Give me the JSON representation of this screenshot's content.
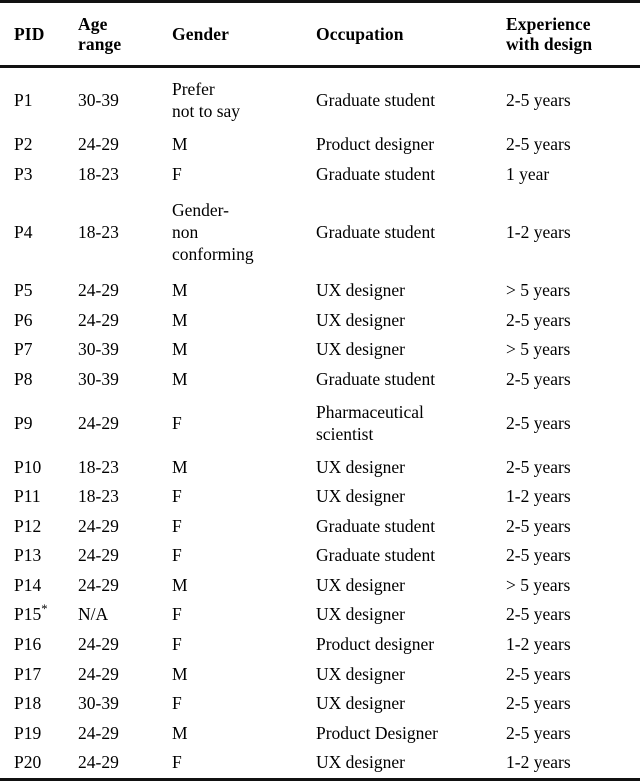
{
  "table": {
    "caption_note": "",
    "columns": [
      {
        "key": "pid",
        "label": "PID"
      },
      {
        "key": "age_range",
        "label": "Age\nrange"
      },
      {
        "key": "gender",
        "label": "Gender"
      },
      {
        "key": "occupation",
        "label": "Occupation"
      },
      {
        "key": "experience",
        "label": "Experience\nwith design"
      }
    ],
    "rows": [
      {
        "pid": "P1",
        "age_range": "30-39",
        "gender": "Prefer\nnot to say",
        "occupation": "Graduate student",
        "experience": "2-5 years",
        "lines": 2
      },
      {
        "pid": "P2",
        "age_range": "24-29",
        "gender": "M",
        "occupation": "Product designer",
        "experience": "2-5 years",
        "lines": 1
      },
      {
        "pid": "P3",
        "age_range": "18-23",
        "gender": "F",
        "occupation": "Graduate student",
        "experience": "1 year",
        "lines": 1
      },
      {
        "pid": "P4",
        "age_range": "18-23",
        "gender": "Gender-\nnon\nconforming",
        "occupation": "Graduate student",
        "experience": "1-2 years",
        "lines": 3
      },
      {
        "pid": "P5",
        "age_range": "24-29",
        "gender": "M",
        "occupation": "UX designer",
        "experience": "> 5 years",
        "lines": 1
      },
      {
        "pid": "P6",
        "age_range": "24-29",
        "gender": "M",
        "occupation": "UX designer",
        "experience": "2-5 years",
        "lines": 1
      },
      {
        "pid": "P7",
        "age_range": "30-39",
        "gender": "M",
        "occupation": "UX designer",
        "experience": "> 5 years",
        "lines": 1
      },
      {
        "pid": "P8",
        "age_range": "30-39",
        "gender": "M",
        "occupation": "Graduate student",
        "experience": "2-5 years",
        "lines": 1
      },
      {
        "pid": "P9",
        "age_range": "24-29",
        "gender": "F",
        "occupation": "Pharmaceutical\nscientist",
        "experience": "2-5 years",
        "lines": 2
      },
      {
        "pid": "P10",
        "age_range": "18-23",
        "gender": "M",
        "occupation": "UX designer",
        "experience": "2-5 years",
        "lines": 1
      },
      {
        "pid": "P11",
        "age_range": "18-23",
        "gender": "F",
        "occupation": "UX designer",
        "experience": "1-2 years",
        "lines": 1
      },
      {
        "pid": "P12",
        "age_range": "24-29",
        "gender": "F",
        "occupation": "Graduate student",
        "experience": "2-5 years",
        "lines": 1
      },
      {
        "pid": "P13",
        "age_range": "24-29",
        "gender": "F",
        "occupation": "Graduate student",
        "experience": "2-5 years",
        "lines": 1
      },
      {
        "pid": "P14",
        "age_range": "24-29",
        "gender": "M",
        "occupation": "UX designer",
        "experience": "> 5 years",
        "lines": 1
      },
      {
        "pid": "P15*",
        "age_range": "N/A",
        "gender": "F",
        "occupation": "UX designer",
        "experience": "2-5 years",
        "lines": 1
      },
      {
        "pid": "P16",
        "age_range": "24-29",
        "gender": "F",
        "occupation": "Product designer",
        "experience": "1-2 years",
        "lines": 1
      },
      {
        "pid": "P17",
        "age_range": "24-29",
        "gender": "M",
        "occupation": "UX designer",
        "experience": "2-5 years",
        "lines": 1
      },
      {
        "pid": "P18",
        "age_range": "30-39",
        "gender": "F",
        "occupation": "UX designer",
        "experience": "2-5 years",
        "lines": 1
      },
      {
        "pid": "P19",
        "age_range": "24-29",
        "gender": "M",
        "occupation": "Product Designer",
        "experience": "2-5 years",
        "lines": 1
      },
      {
        "pid": "P20",
        "age_range": "24-29",
        "gender": "F",
        "occupation": "UX designer",
        "experience": "1-2 years",
        "lines": 1
      }
    ]
  },
  "colors": {
    "text": "#000000",
    "rule": "#111111",
    "background": "#ffffff"
  }
}
